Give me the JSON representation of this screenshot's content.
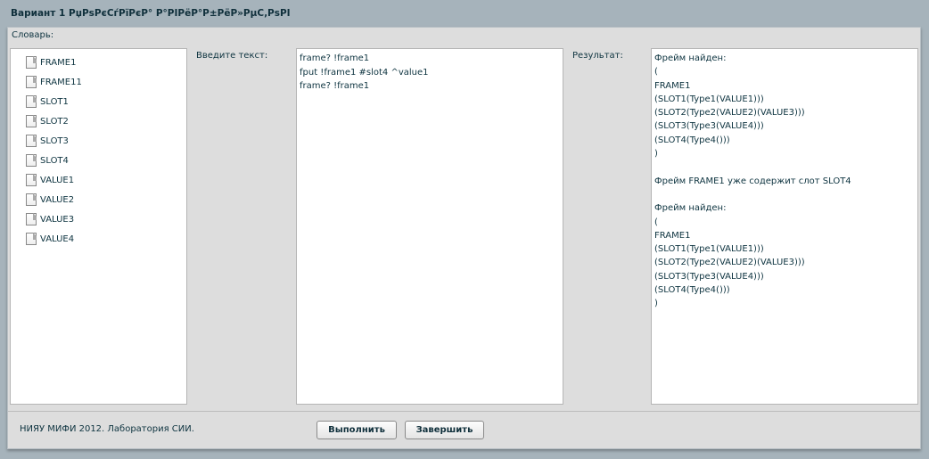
{
  "window": {
    "title": "Вариант 1 РџРѕРєСѓРїРєР° Р°РІРёР°Р±РёР»РµС‚РѕРІ"
  },
  "dictionary": {
    "label": "Словарь:",
    "items": [
      "FRAME1",
      "FRAME11",
      "SLOT1",
      "SLOT2",
      "SLOT3",
      "SLOT4",
      "VALUE1",
      "VALUE2",
      "VALUE3",
      "VALUE4"
    ]
  },
  "input": {
    "label": "Введите текст:",
    "value": "frame? !frame1\nfput !frame1 #slot4 ^value1\nframe? !frame1"
  },
  "result": {
    "label": "Результат:",
    "value": "Фрейм найден:\n(\nFRAME1\n(SLOT1(Type1(VALUE1)))\n(SLOT2(Type2(VALUE2)(VALUE3)))\n(SLOT3(Type3(VALUE4)))\n(SLOT4(Type4()))\n)\n\nФрейм FRAME1 уже содержит слот SLOT4\n\nФрейм найден:\n(\nFRAME1\n(SLOT1(Type1(VALUE1)))\n(SLOT2(Type2(VALUE2)(VALUE3)))\n(SLOT3(Type3(VALUE4)))\n(SLOT4(Type4()))\n)"
  },
  "footer": {
    "copyright": "НИЯУ МИФИ 2012. Лаборатория СИИ.",
    "execute": "Выполнить",
    "finish": "Завершить"
  }
}
